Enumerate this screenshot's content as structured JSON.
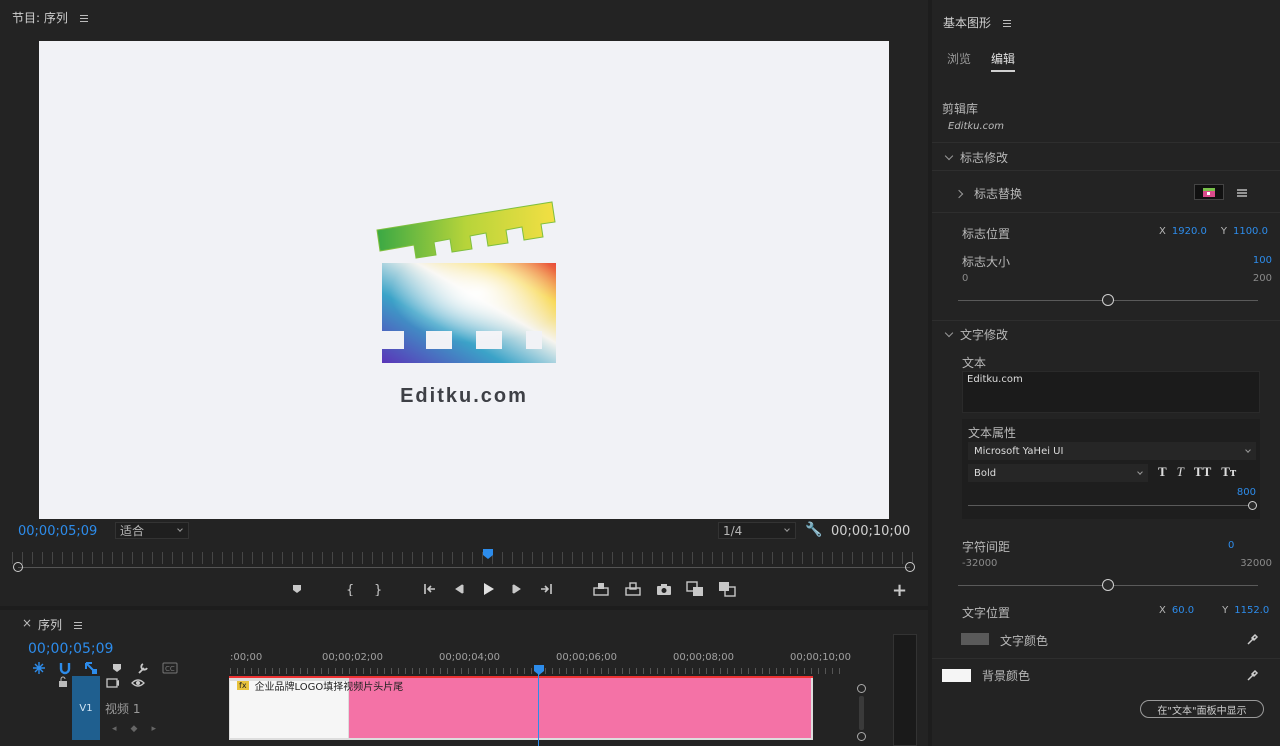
{
  "program": {
    "title": "节目: 序列",
    "logo_text": "Editku.com",
    "timecode_current": "00;00;05;09",
    "zoom_value": "适合",
    "resolution_value": "1/4",
    "timecode_duration": "00;00;10;00"
  },
  "timeline": {
    "tab_label": "序列",
    "timecode": "00;00;05;09",
    "ruler_labels": [
      ":00;00",
      "00;00;02;00",
      "00;00;04;00",
      "00;00;06;00",
      "00;00;08;00",
      "00;00;10;00"
    ],
    "track_badge": "V1",
    "track_name": "视频 1",
    "clip_label": "企业品牌LOGO填择视频片头片尾",
    "clip_fx": "fx"
  },
  "egp": {
    "title": "基本图形",
    "tab_browse": "浏览",
    "tab_edit": "编辑",
    "library_label": "剪辑库",
    "library_item": "Editku.com",
    "section_logo": "标志修改",
    "logo_replace": "标志替换",
    "logo_position": "标志位置",
    "logo_pos_x_label": "X",
    "logo_pos_x": "1920.0",
    "logo_pos_y_label": "Y",
    "logo_pos_y": "1100.0",
    "logo_size": "标志大小",
    "logo_size_value": "100",
    "logo_size_min": "0",
    "logo_size_max": "200",
    "logo_size_fraction": 0.5,
    "section_text": "文字修改",
    "text_label": "文本",
    "text_value": "Editku.com",
    "text_props": "文本属性",
    "font_family": "Microsoft YaHei UI",
    "font_style": "Bold",
    "style_buttons": [
      "T",
      "T",
      "TT",
      "Tт"
    ],
    "font_size": "800",
    "tracking": "字符间距",
    "tracking_value": "0",
    "tracking_min": "-32000",
    "tracking_max": "32000",
    "tracking_fraction": 0.5,
    "text_position": "文字位置",
    "text_pos_x_label": "X",
    "text_pos_x": "60.0",
    "text_pos_y_label": "Y",
    "text_pos_y": "1152.0",
    "text_color": "文字颜色",
    "bg_color": "背景颜色",
    "show_in_text_panel": "在\"文本\"面板中显示"
  },
  "colors": {
    "accent": "#2d8ceb",
    "clip": "#f472a6",
    "track_badge": "#1f5f8f",
    "text_swatch": "#5a5a5a",
    "bg_swatch": "#f5f5f5"
  }
}
